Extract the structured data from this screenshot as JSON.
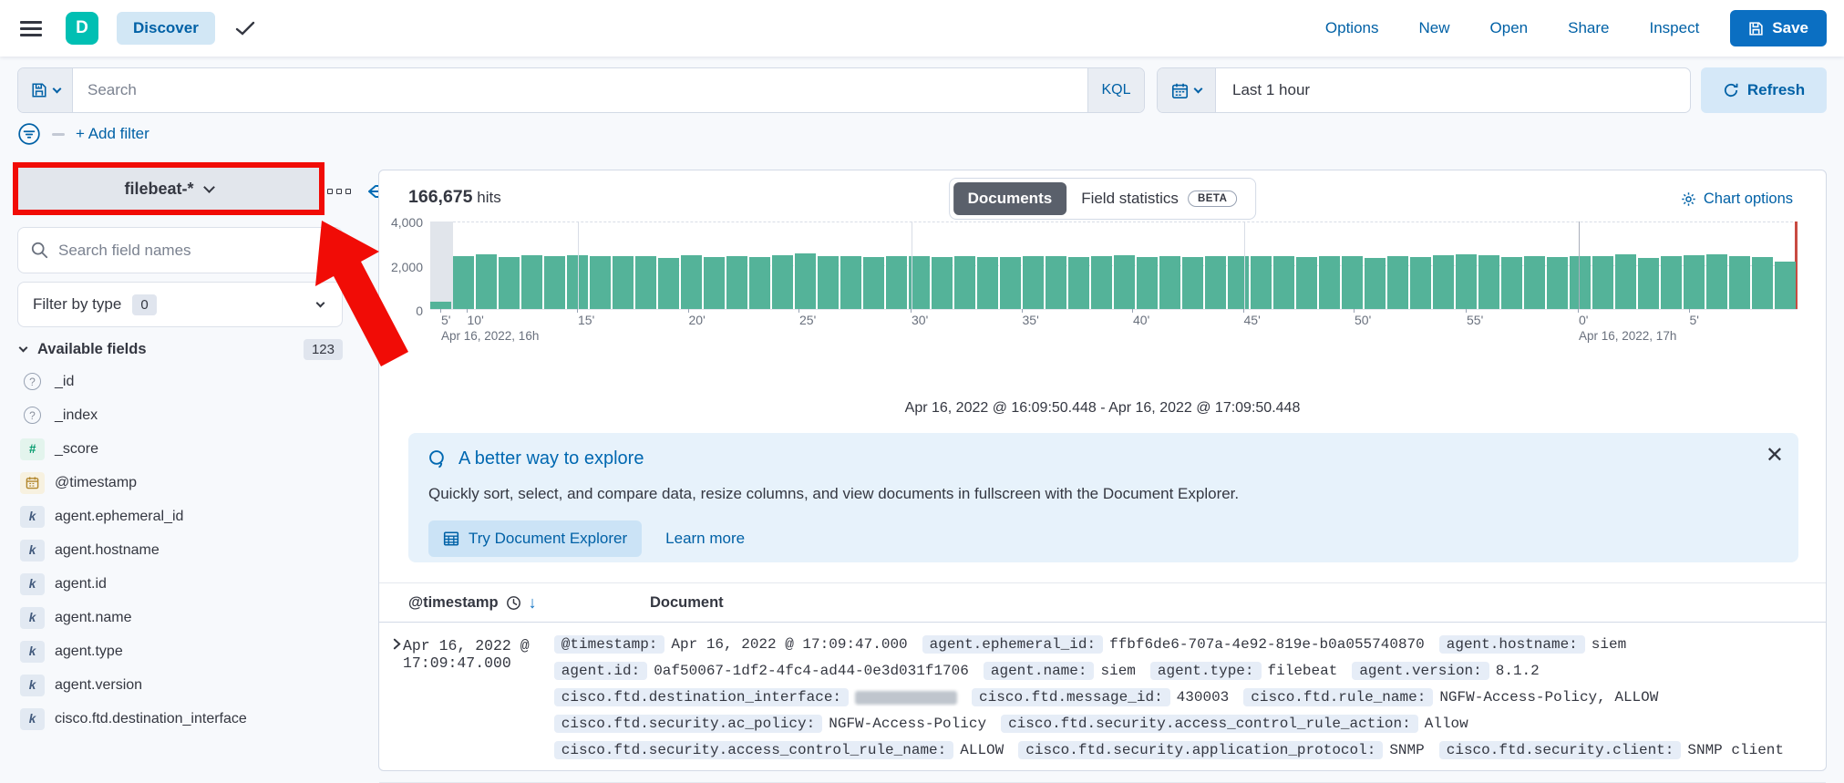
{
  "header": {
    "app_initial": "D",
    "page_badge": "Discover",
    "nav": [
      "Options",
      "New",
      "Open",
      "Share",
      "Inspect"
    ],
    "save_label": "Save"
  },
  "query_bar": {
    "search_placeholder": "Search",
    "language_badge": "KQL",
    "time_range": "Last 1 hour",
    "refresh_label": "Refresh",
    "add_filter_label": "+ Add filter"
  },
  "sidebar": {
    "index_pattern": "filebeat-*",
    "field_search_placeholder": "Search field names",
    "filter_by_type_label": "Filter by type",
    "filter_by_type_count": "0",
    "available_fields_label": "Available fields",
    "available_fields_count": "123",
    "fields": [
      {
        "type": "unknown",
        "name": "_id"
      },
      {
        "type": "unknown",
        "name": "_index"
      },
      {
        "type": "number",
        "name": "_score"
      },
      {
        "type": "date",
        "name": "@timestamp"
      },
      {
        "type": "keyword",
        "name": "agent.ephemeral_id"
      },
      {
        "type": "keyword",
        "name": "agent.hostname"
      },
      {
        "type": "keyword",
        "name": "agent.id"
      },
      {
        "type": "keyword",
        "name": "agent.name"
      },
      {
        "type": "keyword",
        "name": "agent.type"
      },
      {
        "type": "keyword",
        "name": "agent.version"
      },
      {
        "type": "keyword",
        "name": "cisco.ftd.destination_interface"
      }
    ]
  },
  "main": {
    "hits_count": "166,675",
    "hits_label": "hits",
    "tabs": [
      {
        "label": "Documents",
        "selected": true
      },
      {
        "label": "Field statistics",
        "selected": false,
        "beta": "BETA"
      }
    ],
    "chart_options_label": "Chart options",
    "time_range_caption": "Apr 16, 2022 @ 16:09:50.448 - Apr 16, 2022 @ 17:09:50.448",
    "callout": {
      "title": "A better way to explore",
      "body": "Quickly sort, select, and compare data, resize columns, and view documents in fullscreen with the Document Explorer.",
      "primary_button": "Try Document Explorer",
      "link": "Learn more"
    },
    "table": {
      "columns": [
        "@timestamp",
        "Document"
      ],
      "rows": [
        {
          "timestamp": "Apr 16, 2022 @ 17:09:47.000",
          "document_lines": [
            [
              {
                "f": "@timestamp",
                "v": "Apr 16, 2022 @ 17:09:47.000"
              },
              {
                "f": "agent.ephemeral_id",
                "v": "ffbf6de6-707a-4e92-819e-b0a055740870"
              },
              {
                "f": "agent.hostname",
                "v": "siem"
              }
            ],
            [
              {
                "f": "agent.id",
                "v": "0af50067-1df2-4fc4-ad44-0e3d031f1706"
              },
              {
                "f": "agent.name",
                "v": "siem"
              },
              {
                "f": "agent.type",
                "v": "filebeat"
              },
              {
                "f": "agent.version",
                "v": "8.1.2"
              }
            ],
            [
              {
                "f": "cisco.ftd.destination_interface",
                "v": "",
                "redacted": true
              },
              {
                "f": "cisco.ftd.message_id",
                "v": "430003"
              },
              {
                "f": "cisco.ftd.rule_name",
                "v": "NGFW-Access-Policy, ALLOW"
              }
            ],
            [
              {
                "f": "cisco.ftd.security.ac_policy",
                "v": "NGFW-Access-Policy"
              },
              {
                "f": "cisco.ftd.security.access_control_rule_action",
                "v": "Allow"
              }
            ],
            [
              {
                "f": "cisco.ftd.security.access_control_rule_name",
                "v": "ALLOW"
              },
              {
                "f": "cisco.ftd.security.application_protocol",
                "v": "SNMP"
              },
              {
                "f": "cisco.ftd.security.client",
                "v": "SNMP client"
              }
            ]
          ]
        }
      ]
    }
  },
  "chart_data": {
    "type": "bar",
    "title": "Histogram of documents per minute",
    "ylim": [
      0,
      4000
    ],
    "y_ticks": [
      "4,000",
      "2,000",
      "0"
    ],
    "grid": true,
    "bar_color": "#54b399",
    "current_time_marker_color": "#c84b42",
    "partial_bucket_band": true,
    "x_ticks": [
      {
        "label": "5'",
        "pct": 0.8
      },
      {
        "label": "10'",
        "pct": 2.7
      },
      {
        "label": "15'",
        "pct": 10.8,
        "gridline": true
      },
      {
        "label": "20'",
        "pct": 18.9
      },
      {
        "label": "25'",
        "pct": 27.0
      },
      {
        "label": "30'",
        "pct": 35.2,
        "gridline": true
      },
      {
        "label": "35'",
        "pct": 43.3
      },
      {
        "label": "40'",
        "pct": 51.4
      },
      {
        "label": "45'",
        "pct": 59.5,
        "gridline": true
      },
      {
        "label": "50'",
        "pct": 67.6
      },
      {
        "label": "55'",
        "pct": 75.8
      },
      {
        "label": "0'",
        "pct": 84.0,
        "gridline": true,
        "major": true
      },
      {
        "label": "5'",
        "pct": 92.1
      }
    ],
    "x_secondary": [
      {
        "label": "Apr 16, 2022, 16h",
        "pct": 0.8
      },
      {
        "label": "Apr 16, 2022, 17h",
        "pct": 84.0
      }
    ],
    "values": [
      330,
      2420,
      2480,
      2360,
      2440,
      2400,
      2470,
      2420,
      2400,
      2410,
      2330,
      2460,
      2370,
      2410,
      2360,
      2450,
      2540,
      2410,
      2430,
      2380,
      2400,
      2410,
      2380,
      2400,
      2370,
      2390,
      2430,
      2400,
      2380,
      2410,
      2440,
      2390,
      2400,
      2370,
      2420,
      2400,
      2410,
      2430,
      2380,
      2400,
      2420,
      2350,
      2410,
      2380,
      2470,
      2520,
      2440,
      2390,
      2420,
      2380,
      2430,
      2400,
      2480,
      2330,
      2400,
      2440,
      2500,
      2430,
      2390,
      2150
    ]
  },
  "annotation": {
    "type": "highlight-box-with-arrow",
    "color": "#f10c06",
    "target": "index-pattern-switcher"
  },
  "colors": {
    "primary": "#0b6fc2",
    "link": "#0061a6",
    "bar": "#54b399",
    "teal_logo": "#00bfb3",
    "panel_border": "#d3dae6",
    "callout_bg": "#e7f2fb",
    "selected_tab": "#5a606b"
  }
}
